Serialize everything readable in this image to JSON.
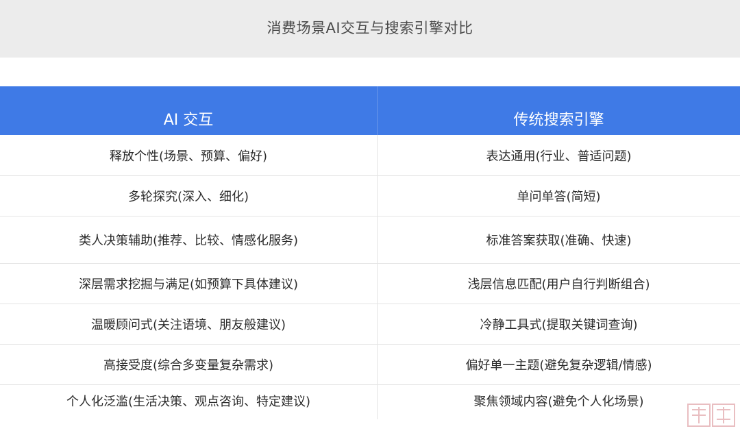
{
  "banner": {
    "title": "消费场景AI交互与搜索引擎对比"
  },
  "table": {
    "headers": [
      "AI 交互",
      "传统搜索引擎"
    ],
    "rows": [
      [
        "释放个性(场景、预算、偏好)",
        "表达通用(行业、普适问题)"
      ],
      [
        "多轮探究(深入、细化)",
        "单问单答(简短)"
      ],
      [
        "类人决策辅助(推荐、比较、情感化服务)",
        "标准答案获取(准确、快速)"
      ],
      [
        "深层需求挖掘与满足(如预算下具体建议)",
        "浅层信息匹配(用户自行判断组合)"
      ],
      [
        "温暖顾问式(关注语境、朋友般建议)",
        "冷静工具式(提取关键词查询)"
      ],
      [
        "高接受度(综合多变量复杂需求)",
        "偏好单一主题(避免复杂逻辑/情感)"
      ],
      [
        "个人化泛滥(生活决策、观点咨询、特定建议)",
        "聚焦领域内容(避免个人化场景)"
      ]
    ]
  },
  "watermark": {
    "text": "人人都是产品经理"
  }
}
